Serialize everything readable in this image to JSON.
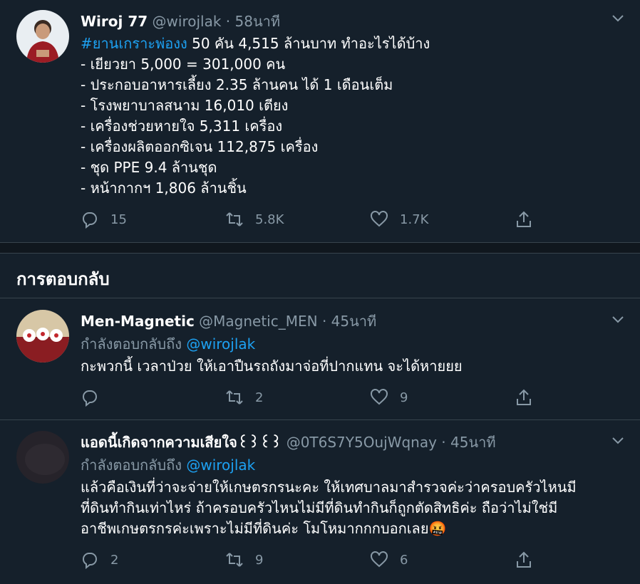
{
  "main_tweet": {
    "name": "Wiroj 77",
    "handle": "@wirojlak",
    "separator": "·",
    "time": "58นาที",
    "hashtag": "#ยานเกราะพ่องง",
    "headline_rest": " 50 คัน 4,515 ล้านบาท ทำอะไรได้บ้าง",
    "lines": [
      "- เยียวยา 5,000 = 301,000 คน",
      "- ประกอบอาหารเลี้ยง 2.35 ล้านคน ได้ 1 เดือนเต็ม",
      "- โรงพยาบาลสนาม 16,010 เตียง",
      "- เครื่องช่วยหายใจ 5,311 เครื่อง",
      "- เครื่องผลิตออกซิเจน 112,875 เครื่อง",
      "- ชุด PPE  9.4 ล้านชุด",
      "- หน้ากากฯ 1,806 ล้านชิ้น"
    ],
    "replies": "15",
    "retweets": "5.8K",
    "likes": "1.7K"
  },
  "section": {
    "title": "การตอบกลับ"
  },
  "replies": [
    {
      "name": "Men-Magnetic",
      "handle": "@Magnetic_MEN",
      "separator": "·",
      "time": "45นาที",
      "replying_label": "กำลังตอบกลับถึง",
      "replying_to": "@wirojlak",
      "lines": [
        "กะพวกนี้ เวลาป่วย ให้เอาปืนรถถังมาจ่อที่ปากแทน จะได้หายยย"
      ],
      "replies": "",
      "retweets": "2",
      "likes": "9"
    },
    {
      "name": "แอดนี้เกิดจากความเสียใจ꒰꒱꒰꒱",
      "handle": "@0T6S7Y5OujWqnay",
      "separator": "·",
      "time": "45นาที",
      "replying_label": "กำลังตอบกลับถึง",
      "replying_to": "@wirojlak",
      "lines": [
        "แล้วคือเงินที่ว่าจะจ่ายให้เกษตรกรนะคะ ให้เทศบาลมาสำรวจค่ะว่าครอบครัวไหนมี",
        "ที่ดินทำกินเท่าไหร่ ถ้าครอบครัวไหนไม่มีที่ดินทำกินก็ถูกตัดสิทธิค่ะ ถือว่าไม่ใช่มี",
        "อาชีพเกษตรกรค่ะเพราะไม่มีที่ดินค่ะ โมโหมากกกบอกเลย"
      ],
      "emoji": "🤬",
      "replies": "2",
      "retweets": "9",
      "likes": "6"
    }
  ],
  "colors": {
    "background": "#15202b",
    "muted": "#8899a6",
    "link": "#1da1f2",
    "divider": "#38444d"
  }
}
